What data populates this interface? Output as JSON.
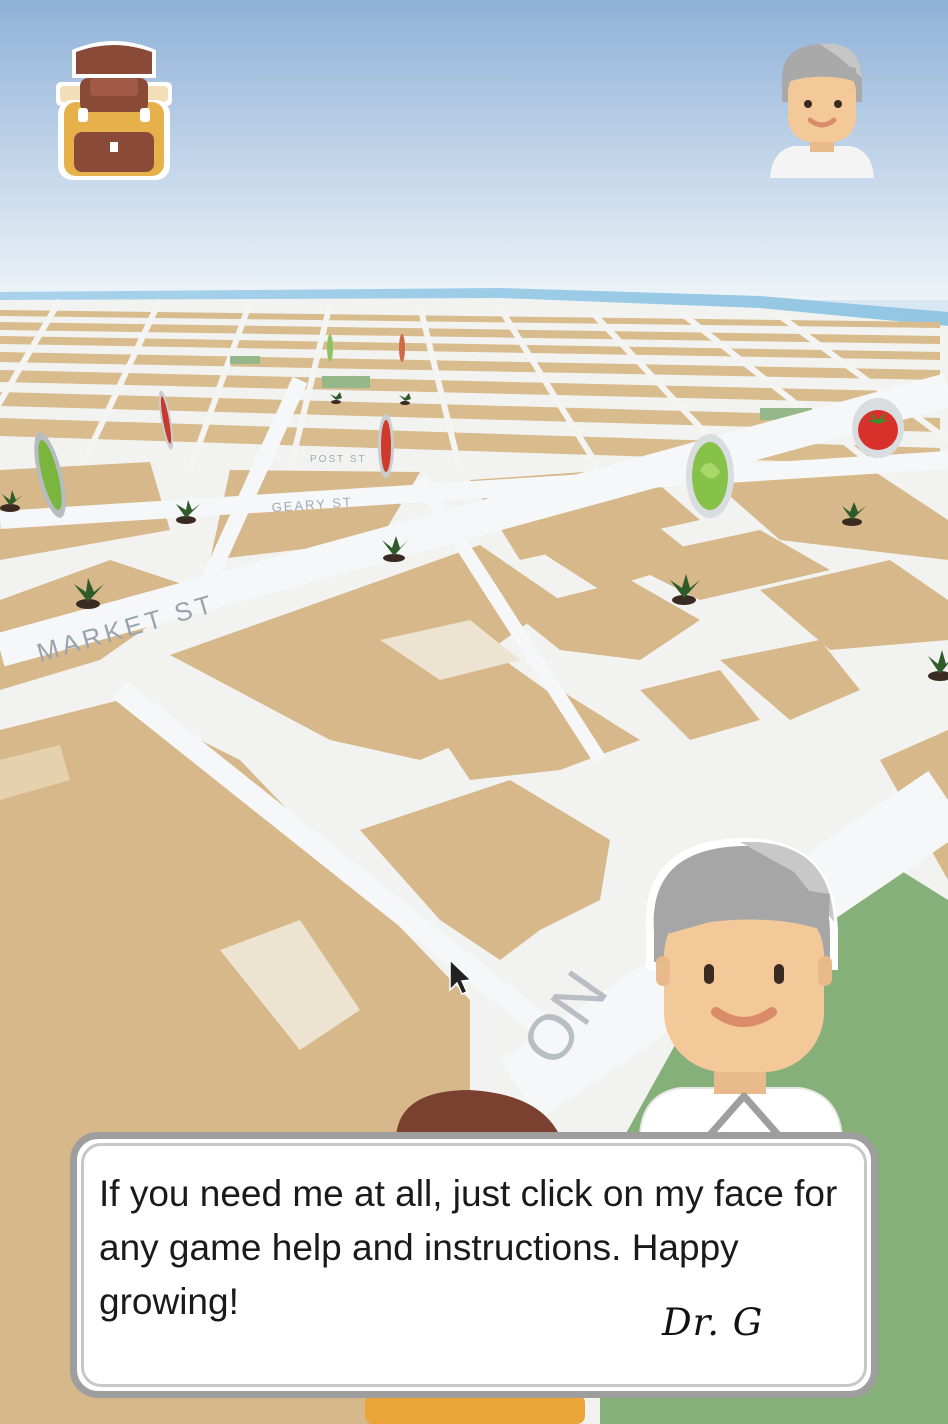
{
  "hud": {
    "backpack_icon": "backpack-icon",
    "help_icon": "dr-g-avatar-icon"
  },
  "map": {
    "streets": [
      "MARKET ST",
      "GEARY ST",
      "POST ST",
      "ON"
    ],
    "colors": {
      "block": "#d6b88a",
      "road": "#f4f6f8",
      "water": "#9ecbe3",
      "park": "#86b07a",
      "sky_top": "#8fb1d8"
    }
  },
  "dialog": {
    "message": "If you need me at all, just click on my face for any game help and instructions. Happy growing!",
    "signature": "Dr. G"
  }
}
